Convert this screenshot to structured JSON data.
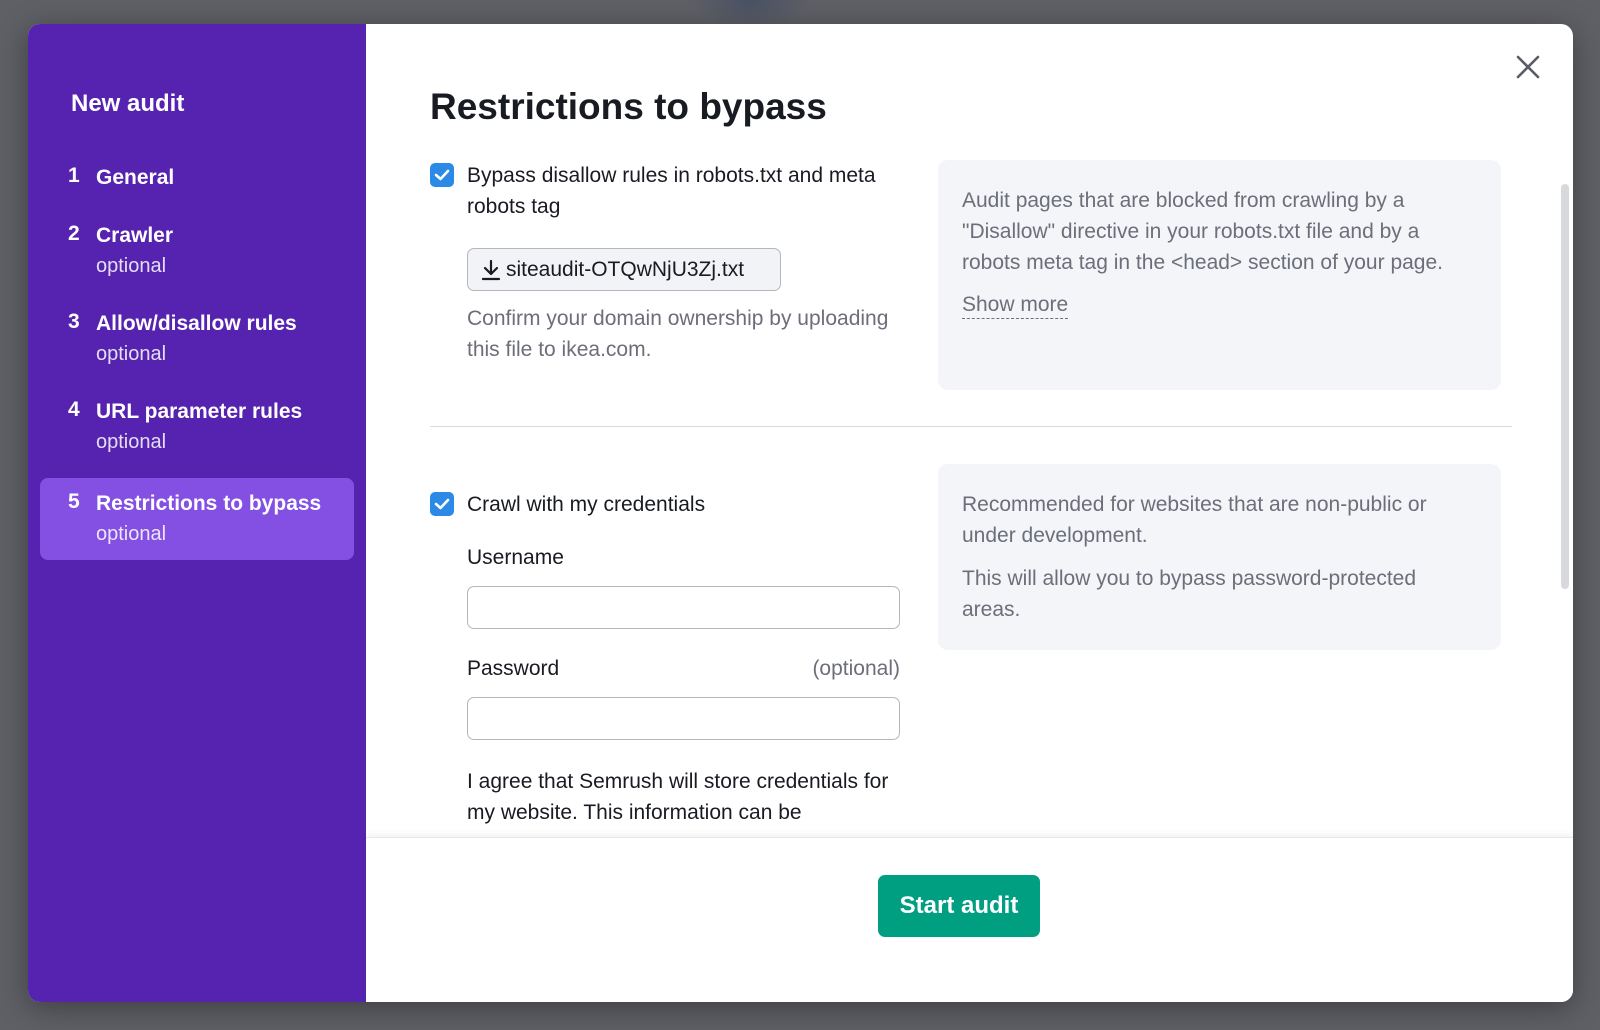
{
  "sidebar": {
    "title": "New audit",
    "steps": [
      {
        "num": "1",
        "label": "General",
        "sub": ""
      },
      {
        "num": "2",
        "label": "Crawler",
        "sub": "optional"
      },
      {
        "num": "3",
        "label": "Allow/disallow rules",
        "sub": "optional"
      },
      {
        "num": "4",
        "label": "URL parameter rules",
        "sub": "optional"
      },
      {
        "num": "5",
        "label": "Restrictions to bypass",
        "sub": "optional"
      }
    ]
  },
  "main": {
    "title": "Restrictions to bypass",
    "section1": {
      "checkbox_label": "Bypass disallow rules in robots.txt and meta robots tag",
      "checked": true,
      "file_name": "siteaudit-OTQwNjU3Zj.txt",
      "hint": "Confirm your domain ownership by uploading this file to ikea.com.",
      "info": "Audit pages that are blocked from crawling by a \"Disallow\" directive in your robots.txt file and by a robots meta tag in the <head> section of your page.",
      "show_more": "Show more"
    },
    "section2": {
      "checkbox_label": "Crawl with my credentials",
      "checked": true,
      "username_label": "Username",
      "username_value": "",
      "password_label": "Password",
      "password_optional": "(optional)",
      "password_value": "",
      "agree_text": "I agree that Semrush will store credentials for my website. This information can be",
      "info_1": "Recommended for websites that are non-public or under development.",
      "info_2": "This will allow you to bypass password-protected areas."
    },
    "start_button": "Start audit"
  },
  "colors": {
    "sidebar_bg": "#5623b0",
    "active_step_bg": "#8450e4",
    "checkbox": "#2a8ae6",
    "primary_button": "#009f81"
  },
  "icons": {
    "close": "close-icon",
    "checkbox": "checkmark-icon",
    "download": "download-icon"
  }
}
